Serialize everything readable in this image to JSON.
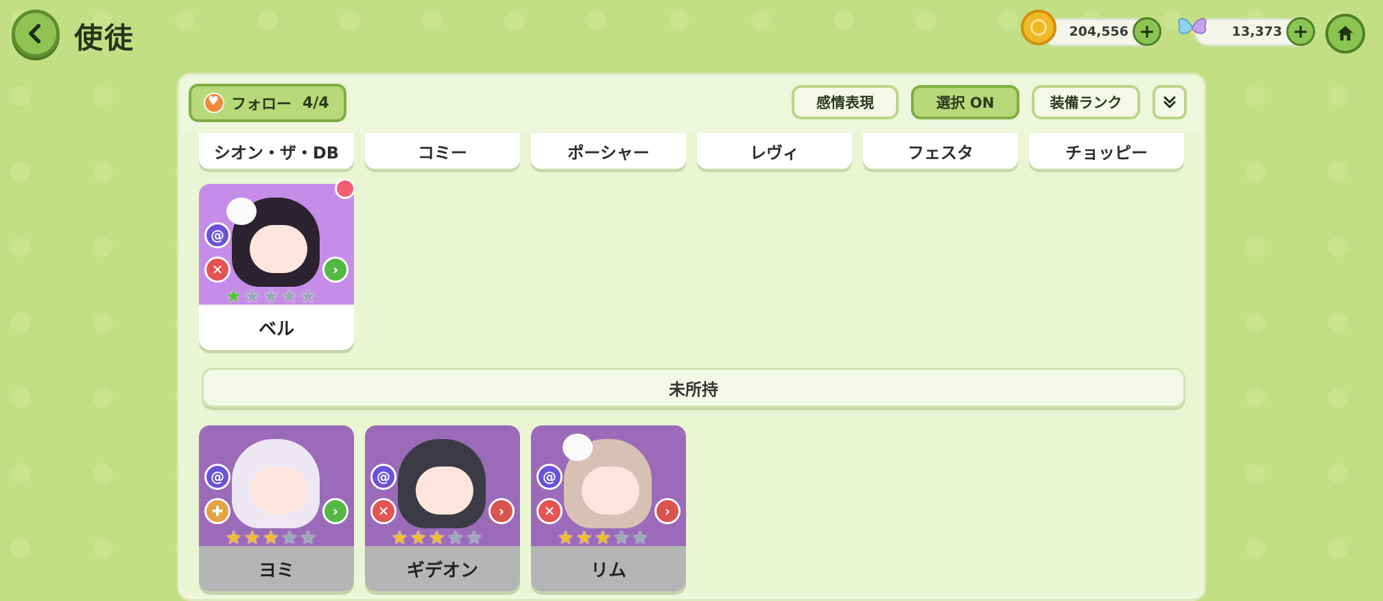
{
  "header": {
    "title": "使徒",
    "gold": "204,556",
    "gems": "13,373"
  },
  "toolbar": {
    "follow_label": "フォロー",
    "follow_count": "4/4",
    "emotion_label": "感情表現",
    "select_label": "選択 ON",
    "equip_rank_label": "装備ランク"
  },
  "name_tabs": [
    "シオン・ザ・DB",
    "コミー",
    "ポーシャー",
    "レヴィ",
    "フェスタ",
    "チョッピー"
  ],
  "owned": [
    {
      "name": "ベル",
      "stars": 1,
      "star_max": 5
    }
  ],
  "unowned_header": "未所持",
  "unowned": [
    {
      "name": "ヨミ",
      "stars": 3,
      "star_max": 5
    },
    {
      "name": "ギデオン",
      "stars": 3,
      "star_max": 5
    },
    {
      "name": "リム",
      "stars": 3,
      "star_max": 5
    }
  ]
}
